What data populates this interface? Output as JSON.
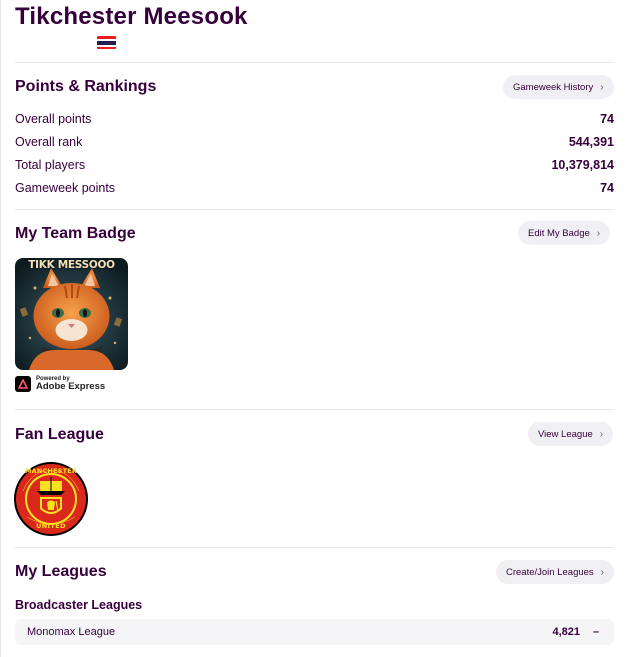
{
  "manager": {
    "name": "Tikchester Meesook",
    "flag_colors": [
      "#ed1c24",
      "#ffffff",
      "#241d4f",
      "#ffffff",
      "#ed1c24"
    ]
  },
  "points_rankings": {
    "title": "Points & Rankings",
    "history_button": "Gameweek History",
    "rows": [
      {
        "label": "Overall points",
        "value": "74"
      },
      {
        "label": "Overall rank",
        "value": "544,391"
      },
      {
        "label": "Total players",
        "value": "10,379,814"
      },
      {
        "label": "Gameweek points",
        "value": "74"
      }
    ]
  },
  "team_badge": {
    "title": "My Team Badge",
    "edit_button": "Edit My Badge",
    "badge_text": "TIKK MESSOOO",
    "powered_by": "Powered by",
    "powered_brand": "Adobe Express"
  },
  "fan_league": {
    "title": "Fan League",
    "view_button": "View League",
    "crest_text_top": "MANCHESTER",
    "crest_text_bottom": "UNITED"
  },
  "my_leagues": {
    "title": "My Leagues",
    "create_button": "Create/Join Leagues",
    "broadcaster_heading": "Broadcaster Leagues",
    "leagues": [
      {
        "name": "Monomax League",
        "rank": "4,821",
        "movement": "–"
      }
    ]
  },
  "colors": {
    "primary": "#37003c",
    "pill_bg": "#f0eff3",
    "divider": "#e4e4e8",
    "crest_red": "#da291c",
    "crest_gold": "#fbe122"
  }
}
